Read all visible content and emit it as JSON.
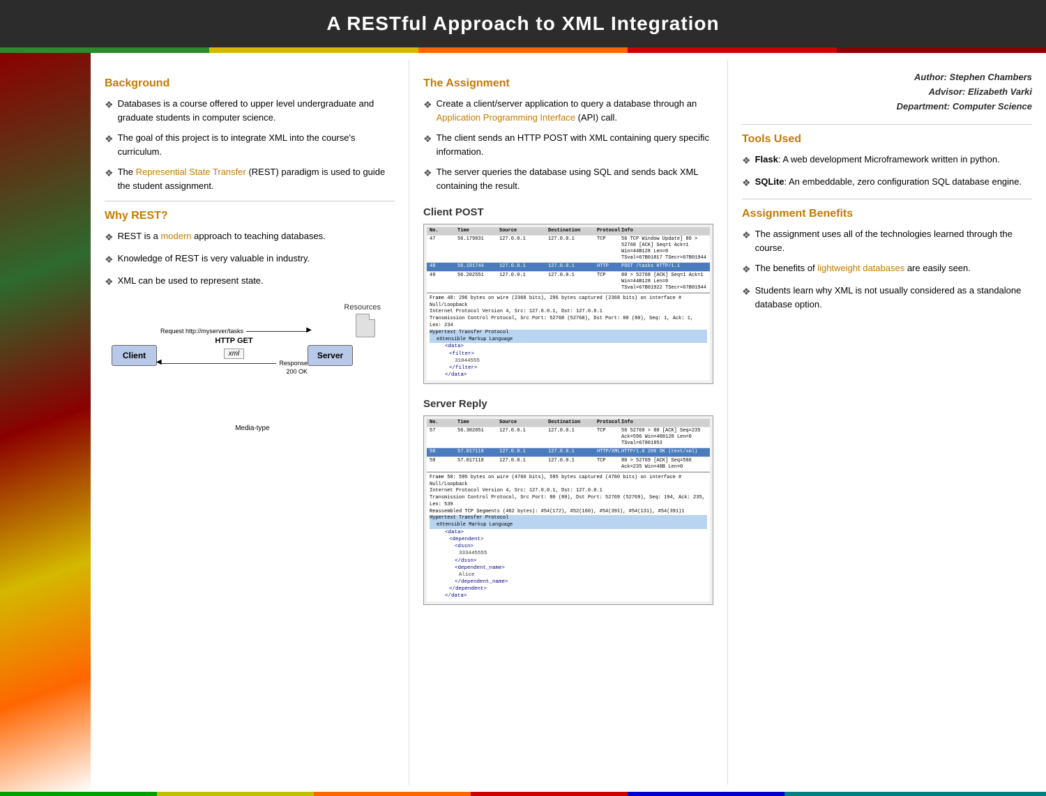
{
  "header": {
    "title": "A RESTful Approach to XML Integration"
  },
  "colorBar": [
    {
      "color": "#2d8a2d"
    },
    {
      "color": "#d4b800"
    },
    {
      "color": "#ff6600"
    },
    {
      "color": "#cc0000"
    },
    {
      "color": "#8B0000"
    }
  ],
  "author": {
    "line1": "Author: Stephen Chambers",
    "line2": "Advisor: Elizabeth Varki",
    "line3": "Department: Computer Science"
  },
  "leftCol": {
    "background_heading": "Background",
    "background_bullets": [
      "Databases is a course offered to upper level undergraduate and graduate students in computer science.",
      "The goal of this project is to integrate XML into the course's curriculum.",
      "The Represential State Transfer (REST) paradigm is used to guide the student assignment."
    ],
    "whyrest_heading": "Why REST?",
    "whyrest_bullets": [
      "REST is a modern approach to teaching databases.",
      "Knowledge of REST is very valuable in industry.",
      "XML can be used to represent state."
    ]
  },
  "midCol": {
    "assignment_heading": "The Assignment",
    "assignment_bullets": [
      "Create a client/server application to query a database through an Application Programming Interface (API) call.",
      "The client sends an HTTP POST with XML containing query specific information.",
      "The server queries the database using SQL and sends back XML containing the result."
    ],
    "client_post_heading": "Client POST",
    "server_reply_heading": "Server Reply",
    "wireshark_client": {
      "header_cols": [
        "No.",
        "Time",
        "Source",
        "Destination",
        "Protocol",
        "Info"
      ],
      "rows": [
        {
          "no": "47",
          "time": "56.179831",
          "src": "127.0.0.1",
          "dst": "127.0.0.1",
          "proto": "TCP",
          "info": "56 TCP Window Update] 80 > 52768 [ACK] Seq=1 Ack=1 Win=44B128 Len=0 TSval=67B01817",
          "selected": false
        },
        {
          "no": "48",
          "time": "56.191744",
          "src": "127.0.0.1",
          "dst": "127.0.0.1",
          "proto": "HTTP",
          "info": "POST /tasks HTTP/1.1",
          "selected": true
        },
        {
          "no": "49",
          "time": "56.202551",
          "src": "127.0.0.1",
          "dst": "127.0.0.1",
          "proto": "TCP",
          "info": "80 > 52768 [ACK] Seq=1 Ack=1 Win=44B128 Len=0 TSval=67B01922 TSecr=67B01944",
          "selected": false
        }
      ],
      "detail_lines": [
        "Frame 48: 296 bytes on wire (2368 bits), 296 bytes captured (2368 bits) on interface #",
        "Null/Loopback",
        "Internet Protocol Version 4, Src: 127.0.0.1, Dst: 127.0.0.1",
        "Transmission Control Protocol, Src Port: 52768 (52768), Dst Port: 80 (80), Seq: 1, Ack: 1, Len: 234",
        "Hypertext Transfer Protocol",
        "  eXtensible Markup Language",
        "    <data>",
        "      <filter>",
        "        31044555",
        "      </filter>",
        "    </data>"
      ]
    },
    "wireshark_server": {
      "rows": [
        {
          "no": "57",
          "time": "56.302051",
          "src": "127.0.0.1",
          "dst": "127.0.0.1",
          "proto": "TCP",
          "info": "56 52769 > 80 [ACK] Seq=235 Ack=596 Win=408128 Len=0 TSval=67801853",
          "selected": false
        },
        {
          "no": "58",
          "time": "57.017118",
          "src": "127.0.0.1",
          "dst": "127.0.0.1",
          "proto": "HTTP/XML",
          "info": "HTTP/1.0 200 OK (text/xml)",
          "selected": true
        },
        {
          "no": "59",
          "time": "57.017118",
          "src": "127.0.0.1",
          "dst": "127.0.0.1",
          "proto": "TCP",
          "info": "80 > 52769 [ACK] Seq=596 Ack=235 Win=40B Len=0",
          "selected": false
        }
      ],
      "detail_lines": [
        "Frame 58: 595 bytes on wire (4760 bits), 595 bytes captured (4760 bits) on interface #",
        "Null/Loopback",
        "Internet Protocol Version 4, Src: 127.0.0.1, Dst: 127.0.0.1",
        "Transmission Control Protocol, Src Port: 80 (80), Dst Port: 52769 (52769), Seq: 194, Ack: 235, Len: 539",
        "Reassembled TCP Segments (462 bytes): #54(172), #52(160), #54(391), #54(131), #54(391)1",
        "Hypertext Transfer Protocol",
        "  eXtensible Markup Language",
        "    <data>",
        "      <dependent>",
        "        <dssn>",
        "          333445555",
        "        </dssn>",
        "        <dependent_name>",
        "          Alice",
        "        </dependent_name>",
        "      </dependent>",
        "    </data>"
      ]
    }
  },
  "rightCol": {
    "tools_heading": "Tools Used",
    "tools": [
      {
        "name": "Flask",
        "desc": ": A web development Microframework written in python."
      },
      {
        "name": "SQLite",
        "desc": ": An embeddable, zero configuration SQL database engine."
      }
    ],
    "benefits_heading": "Assignment Benefits",
    "benefits_bullets": [
      "The assignment uses all of the technologies learned through the course.",
      "The benefits of lightweight databases are easily seen.",
      "Students learn why XML is not usually considered as a standalone database option."
    ]
  },
  "diagram": {
    "resources_label": "Resources",
    "client_label": "Client",
    "server_label": "Server",
    "request_label": "Request  http://myserver/tasks",
    "response_label": "Response",
    "response_code": "200 OK",
    "http_get_label": "HTTP GET",
    "xml_label": "xml",
    "media_type_label": "Media-type"
  }
}
